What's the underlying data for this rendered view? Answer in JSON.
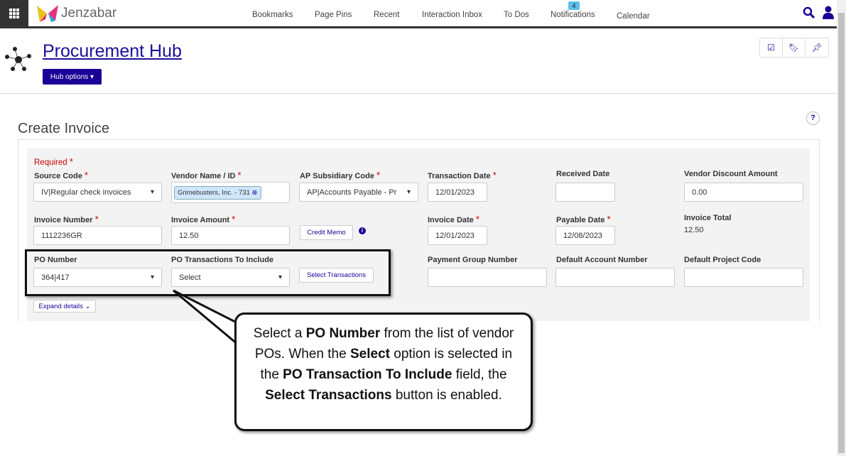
{
  "header": {
    "brand": "Jenzabar",
    "nav": [
      "Bookmarks",
      "Page Pins",
      "Recent",
      "Interaction Inbox",
      "To Dos",
      "Notifications",
      "Calendar"
    ],
    "notification_count": "4"
  },
  "hub": {
    "title": "Procurement Hub",
    "options_label": "Hub options ▾"
  },
  "page": {
    "title": "Create Invoice",
    "help": "?",
    "required": "Required"
  },
  "form": {
    "source_code": {
      "label": "Source Code",
      "value": "IV|Regular check invoices"
    },
    "vendor": {
      "label": "Vendor Name / ID",
      "value": "Grimebusters, Inc. - 731"
    },
    "ap_code": {
      "label": "AP Subsidiary Code",
      "value": "AP|Accounts Payable - Pr"
    },
    "transaction_date": {
      "label": "Transaction Date",
      "value": "12/01/2023"
    },
    "received_date": {
      "label": "Received Date",
      "value": ""
    },
    "vendor_discount": {
      "label": "Vendor Discount Amount",
      "value": "0.00"
    },
    "invoice_number": {
      "label": "Invoice Number",
      "value": "1112236GR"
    },
    "invoice_amount": {
      "label": "Invoice Amount",
      "value": "12.50"
    },
    "credit_memo": "Credit Memo",
    "invoice_date": {
      "label": "Invoice Date",
      "value": "12/01/2023"
    },
    "payable_date": {
      "label": "Payable Date",
      "value": "12/08/2023"
    },
    "invoice_total": {
      "label": "Invoice Total",
      "value": "12.50"
    },
    "po_number": {
      "label": "PO Number",
      "value": "364|417"
    },
    "po_transactions": {
      "label": "PO Transactions To Include",
      "value": "Select"
    },
    "select_transactions": "Select Transactions",
    "payment_group": {
      "label": "Payment Group Number",
      "value": ""
    },
    "default_account": {
      "label": "Default Account Number",
      "value": ""
    },
    "default_project": {
      "label": "Default Project Code",
      "value": ""
    },
    "expand": "Expand details ⌄"
  },
  "callout": [
    "Select a ",
    "PO Number",
    " from the list of vendor POs. When the ",
    "Select",
    " option is selected in the ",
    "PO Transaction To Include",
    " field, the ",
    "Select Transactions",
    " button is enabled."
  ],
  "colors": {
    "accent": "#1a0096",
    "required": "#cc0000",
    "badge": "#5bc0eb"
  }
}
